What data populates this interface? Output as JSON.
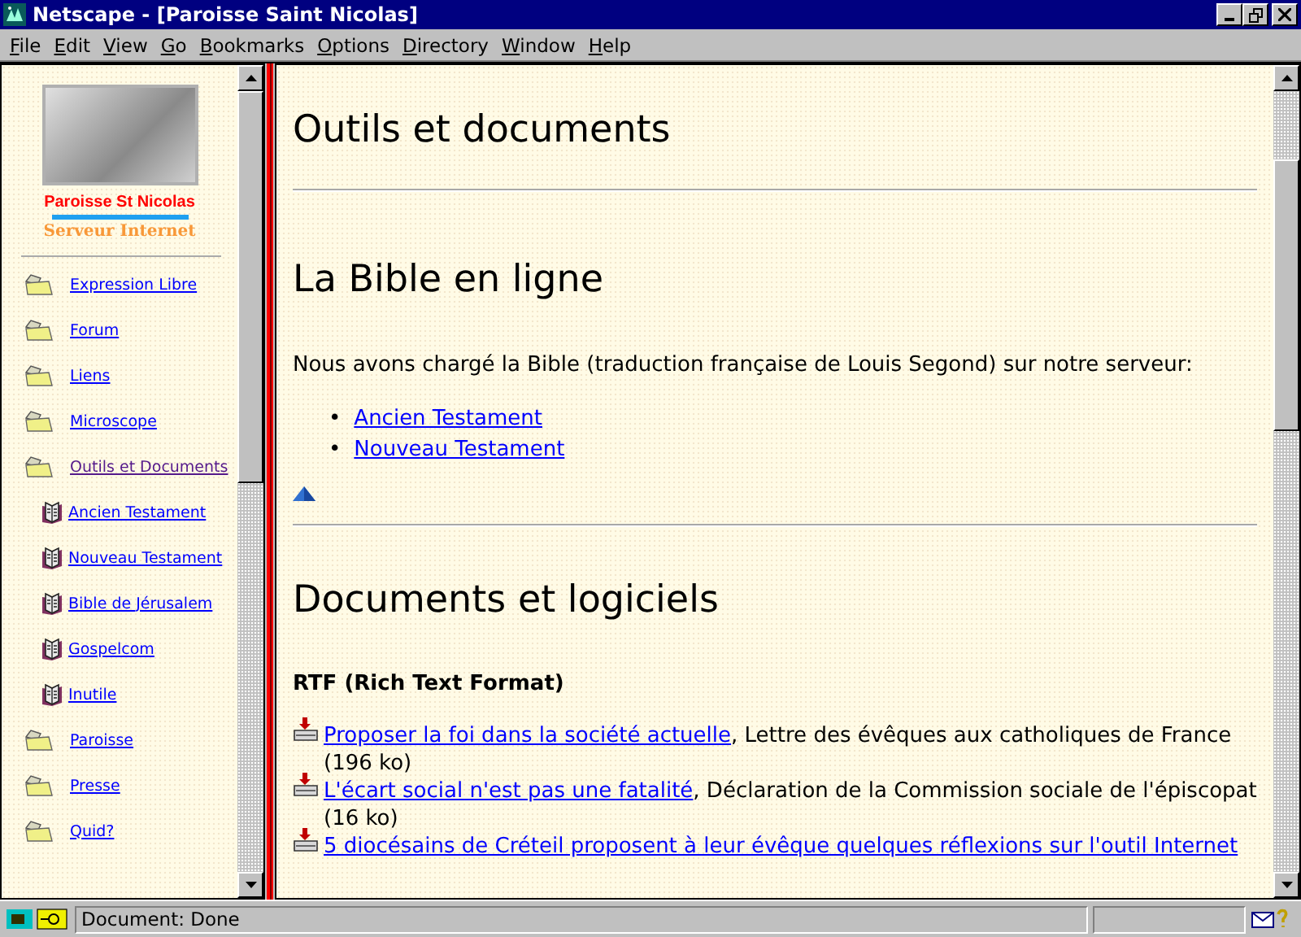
{
  "window": {
    "title": "Netscape - [Paroisse Saint Nicolas]"
  },
  "menu": [
    "File",
    "Edit",
    "View",
    "Go",
    "Bookmarks",
    "Options",
    "Directory",
    "Window",
    "Help"
  ],
  "sidebar": {
    "logo_title": "Paroisse St Nicolas",
    "logo_subtitle": "Serveur Internet",
    "items": [
      {
        "kind": "folder",
        "label": "Expression Libre",
        "visited": false
      },
      {
        "kind": "folder",
        "label": "Forum",
        "visited": false
      },
      {
        "kind": "folder",
        "label": "Liens",
        "visited": false
      },
      {
        "kind": "folder",
        "label": "Microscope",
        "visited": false
      },
      {
        "kind": "folder",
        "label": "Outils et Documents",
        "visited": true,
        "children": [
          {
            "kind": "book",
            "label": "Ancien Testament",
            "visited": false
          },
          {
            "kind": "book",
            "label": "Nouveau Testament",
            "visited": false
          },
          {
            "kind": "book",
            "label": "Bible de Jérusalem",
            "visited": false
          },
          {
            "kind": "book",
            "label": "Gospelcom",
            "visited": false
          },
          {
            "kind": "book",
            "label": "Inutile",
            "visited": false
          }
        ]
      },
      {
        "kind": "folder",
        "label": "Paroisse",
        "visited": false
      },
      {
        "kind": "folder",
        "label": "Presse",
        "visited": false
      },
      {
        "kind": "folder",
        "label": "Quid?",
        "visited": false
      }
    ]
  },
  "main": {
    "title": "Outils et documents",
    "sections": [
      {
        "heading": "La Bible en ligne",
        "intro": "Nous avons chargé la Bible (traduction française de Louis Segond) sur notre serveur:",
        "links": [
          {
            "bullet": "•",
            "label": "Ancien Testament"
          },
          {
            "bullet": "•",
            "label": "Nouveau Testament"
          }
        ]
      },
      {
        "heading": "Documents et logiciels",
        "subheading": "RTF (Rich Text Format)",
        "downloads": [
          {
            "link": "Proposer la foi dans la société actuelle",
            "description": ", Lettre des évêques aux catholiques de France (196 ko)"
          },
          {
            "link": "L'écart social n'est pas une fatalité",
            "description": ", Déclaration de la Commission sociale de l'épiscopat (16 ko)"
          },
          {
            "link": "5 diocésains de Créteil proposent à leur évêque quelques réflexions sur l'outil Internet"
          }
        ]
      }
    ]
  },
  "status_bar": {
    "text": "Document: Done"
  }
}
